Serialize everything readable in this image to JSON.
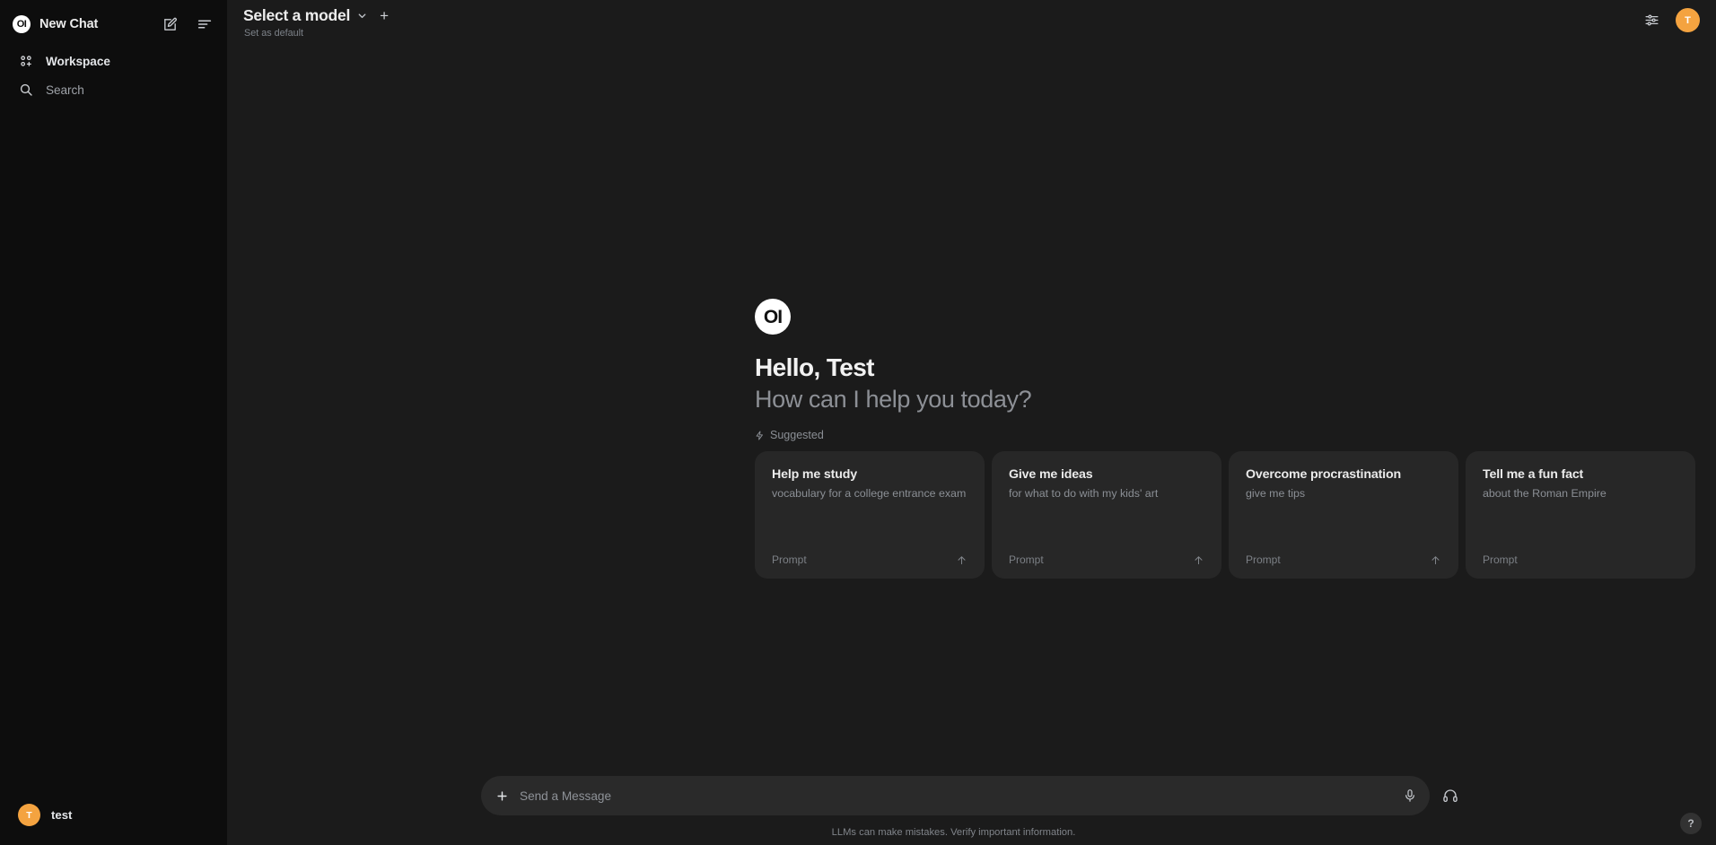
{
  "sidebar": {
    "brand": {
      "logo_text": "OI",
      "title": "New Chat",
      "logo_icon": "openwebui-logo-icon"
    },
    "header_icons": [
      {
        "name": "new-chat-edit-icon",
        "label": "New chat"
      },
      {
        "name": "toggle-sidebar-icon",
        "label": "Toggle sidebar"
      }
    ],
    "items": [
      {
        "label": "Workspace",
        "icon": "workspace-grid-icon"
      },
      {
        "label": "Search",
        "icon": "search-icon"
      }
    ],
    "user": {
      "name": "test",
      "initial": "T",
      "avatar_color": "#f4a340"
    }
  },
  "topbar": {
    "model_name": "Select a model",
    "set_as_default": "Set as default",
    "chevron_icon": "chevron-down-icon",
    "add_model_icon": "plus-icon",
    "controls_icon": "sliders-icon",
    "avatar": {
      "initial": "T",
      "color": "#f4a340"
    }
  },
  "hero": {
    "logo_text": "OI",
    "greeting": "Hello, Test",
    "subgreeting": "How can I help you today?",
    "suggested_label": "Suggested",
    "suggested_icon": "lightning-bolt-icon"
  },
  "suggestion_cards": [
    {
      "title": "Help me study",
      "subtitle": "vocabulary for a college entrance exam",
      "footer_label": "Prompt",
      "arrow_icon": "arrow-up-icon",
      "show_arrow": true
    },
    {
      "title": "Give me ideas",
      "subtitle": "for what to do with my kids' art",
      "footer_label": "Prompt",
      "arrow_icon": "arrow-up-icon",
      "show_arrow": true
    },
    {
      "title": "Overcome procrastination",
      "subtitle": "give me tips",
      "footer_label": "Prompt",
      "arrow_icon": "arrow-up-icon",
      "show_arrow": true
    },
    {
      "title": "Tell me a fun fact",
      "subtitle": "about the Roman Empire",
      "footer_label": "Prompt",
      "arrow_icon": "arrow-up-icon",
      "show_arrow": false
    }
  ],
  "composer": {
    "placeholder": "Send a Message",
    "value": "",
    "attach_icon": "plus-icon",
    "mic_icon": "microphone-icon",
    "call_icon": "headphones-icon"
  },
  "footer": {
    "disclaimer": "LLMs can make mistakes. Verify important information.",
    "help_label": "?"
  },
  "colors": {
    "sidebar_bg": "#0d0d0d",
    "main_bg": "#1b1b1b",
    "card_bg": "#272727",
    "composer_bg": "#2a2a2a",
    "accent": "#f4a340",
    "text_primary": "#ececec",
    "text_muted": "#8b8f95"
  }
}
